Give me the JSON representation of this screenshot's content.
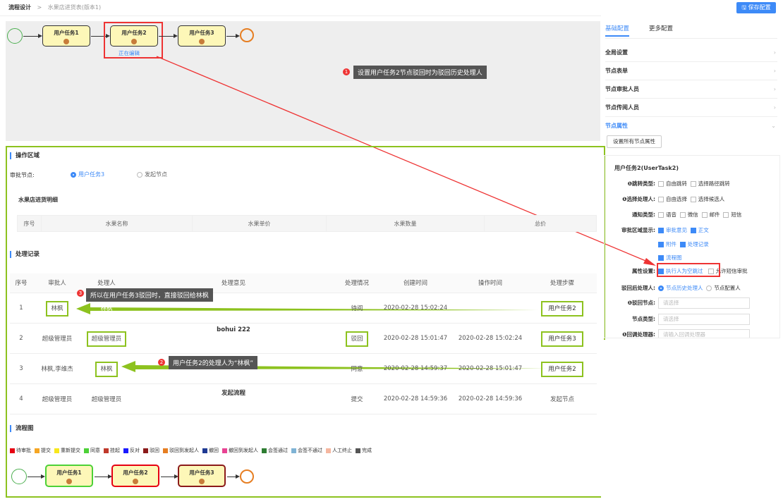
{
  "breadcrumb": {
    "root": "流程设计",
    "sep": ">",
    "current": "水果店进货表(版本1)"
  },
  "toolbar": {
    "save_label": "🖫 保存配置"
  },
  "flow_top": {
    "task1": "用户任务1",
    "task2": "用户任务2",
    "task3": "用户任务3",
    "editing": "正在编辑"
  },
  "annotations": {
    "n1": "1",
    "t1": "设置用户任务2节点驳回时为驳回历史处理人",
    "n2": "2",
    "t2": "用户任务2的处理人为“林枫”",
    "n3": "3",
    "t3": "所以在用户任务3驳回时，直接驳回给林枫"
  },
  "operate": {
    "title": "操作区域",
    "approve_label": "审批节点:",
    "opt1": "用户任务3",
    "opt2": "发起节点"
  },
  "detail": {
    "title": "水果店进货明细",
    "headers": [
      "序号",
      "水果名称",
      "水果单价",
      "水果数量",
      "总价"
    ]
  },
  "records": {
    "title": "处理记录",
    "headers": [
      "序号",
      "审批人",
      "处理人",
      "处理意见",
      "处理情况",
      "创建时间",
      "操作时间",
      "处理步骤"
    ],
    "rows": [
      [
        "1",
        "林枫",
        "林枫",
        "",
        "待阅",
        "2020-02-28 15:02:24",
        "",
        "用户任务2"
      ],
      [
        "2",
        "超级管理员",
        "超级管理员",
        "bohui 222",
        "驳回",
        "2020-02-28 15:01:47",
        "2020-02-28 15:02:24",
        "用户任务3"
      ],
      [
        "3",
        "林枫,李维杰",
        "林枫",
        "",
        "同意",
        "2020-02-28 14:59:37",
        "2020-02-28 15:01:47",
        "用户任务2"
      ],
      [
        "4",
        "超级管理员",
        "超级管理员",
        "发起流程",
        "提交",
        "2020-02-28 14:59:36",
        "2020-02-28 14:59:36",
        "发起节点"
      ]
    ]
  },
  "flowchart": {
    "title": "流程图",
    "legend": [
      {
        "label": "待审批",
        "color": "#e60012"
      },
      {
        "label": "提交",
        "color": "#f5a623"
      },
      {
        "label": "重新提交",
        "color": "#f8e71c"
      },
      {
        "label": "同意",
        "color": "#4cd137"
      },
      {
        "label": "挂起",
        "color": "#c0392b"
      },
      {
        "label": "反对",
        "color": "#1a1aff"
      },
      {
        "label": "驳回",
        "color": "#8b1a1a"
      },
      {
        "label": "驳回到发起人",
        "color": "#e67e22"
      },
      {
        "label": "撤回",
        "color": "#1f3a93"
      },
      {
        "label": "撤回到发起人",
        "color": "#e84393"
      },
      {
        "label": "会签通过",
        "color": "#2e7d32"
      },
      {
        "label": "会签不通过",
        "color": "#7fb3d5"
      },
      {
        "label": "人工终止",
        "color": "#f5b7a0"
      },
      {
        "label": "完成",
        "color": "#555555"
      }
    ],
    "task1": "用户任务1",
    "task2": "用户任务2",
    "task3": "用户任务3"
  },
  "right": {
    "tab1": "基础配置",
    "tab2": "更多配置",
    "menu": [
      "全局设置",
      "节点表单",
      "节点审批人员",
      "节点传阅人员",
      "节点属性"
    ],
    "set_all": "设置所有节点属性",
    "node_title": "用户任务2(UserTask2)",
    "jump_label": "❶跳转类型:",
    "jump_opts": [
      "自由跳转",
      "选择路径跳转"
    ],
    "handler_label": "❶选择处理人:",
    "handler_opts": [
      "自由选择",
      "选择候选人"
    ],
    "notify_label": "通知类型:",
    "notify_opts": [
      "语音",
      "微信",
      "邮件",
      "短信"
    ],
    "area_label": "审批区域显示:",
    "area_opts": [
      "审批意见",
      "正文",
      "附件",
      "处理记录",
      "流程图"
    ],
    "attr_label": "属性设置:",
    "attr_opts": [
      "执行人为空跳过",
      "允许短信审批"
    ],
    "reject_label": "驳回后处理人:",
    "reject_opts": [
      "节点历史处理人",
      "节点配置人"
    ],
    "reject_node_label": "❶驳回节点:",
    "reject_node_ph": "请选择",
    "node_type_label": "节点类型:",
    "node_type_ph": "请选择",
    "callback_label": "❶回调处理器:",
    "callback_ph": "请输入回调处理器"
  }
}
